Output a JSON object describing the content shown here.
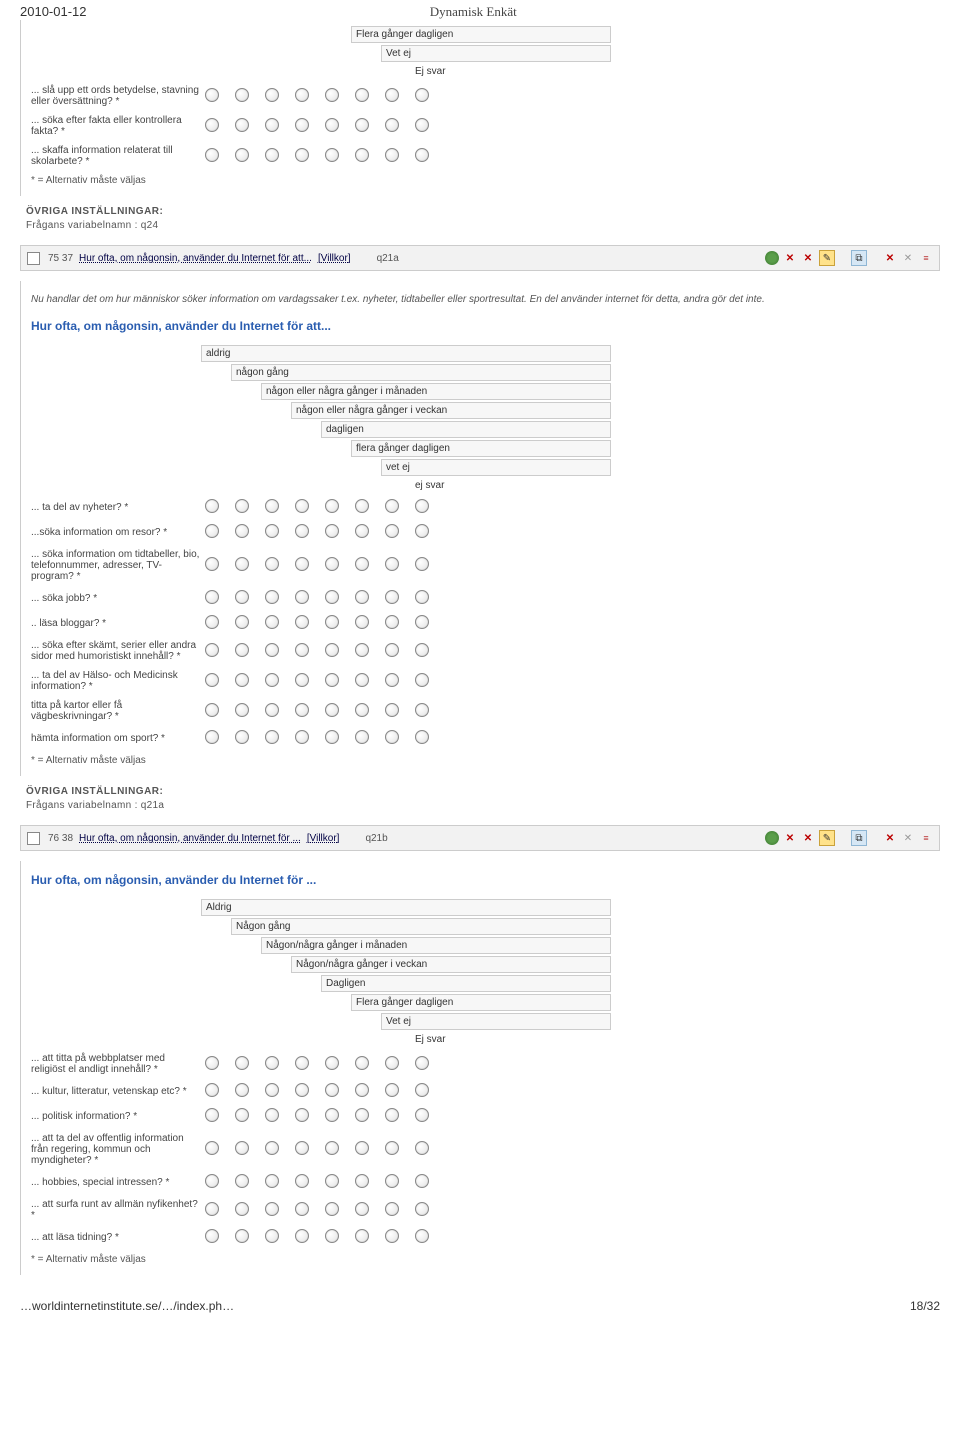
{
  "header": {
    "date": "2010-01-12",
    "title": "Dynamisk Enkät"
  },
  "footer": {
    "left": "…worldinternetinstitute.se/…/index.ph…",
    "right": "18/32"
  },
  "common": {
    "footnote": "* = Alternativ måste väljas",
    "settings_title": "ÖVRIGA INSTÄLLNINGAR:",
    "villkor": "[Villkor]"
  },
  "block_top": {
    "scale_partial": [
      "Flera gånger dagligen",
      "Vet ej",
      "Ej svar"
    ],
    "rows": [
      "... slå upp ett ords betydelse, stavning eller översättning? *",
      "... söka efter fakta eller kontrollera fakta? *",
      "... skaffa information relaterat till skolarbete? *"
    ],
    "variable": "Frågans variabelnamn : q24"
  },
  "q75": {
    "nums": "75  37",
    "link": "Hur ofta, om någonsin, använder du Internet för att...",
    "code": "q21a",
    "preamble": "Nu handlar det om hur människor söker information om vardagssaker t.ex. nyheter, tidtabeller eller sportresultat. En del använder internet för detta, andra gör det inte.",
    "heading": "Hur ofta, om någonsin, använder du Internet för att...",
    "scale": [
      "aldrig",
      "någon gång",
      "någon eller några gånger i månaden",
      "någon eller några gånger i veckan",
      "dagligen",
      "flera gånger dagligen",
      "vet ej",
      "ej svar"
    ],
    "rows": [
      "... ta del av nyheter? *",
      "...söka information om resor? *",
      "... söka information om tidtabeller, bio, telefonnummer, adresser, TV-program? *",
      "... söka jobb? *",
      ".. läsa bloggar? *",
      "... söka efter skämt, serier eller andra sidor med humoristiskt innehåll? *",
      "... ta del av Hälso- och Medicinsk information? *",
      " titta på kartor eller få vägbeskrivningar? *",
      " hämta information om sport? *"
    ],
    "variable": "Frågans variabelnamn : q21a"
  },
  "q76": {
    "nums": "76  38",
    "link": "Hur ofta, om någonsin, använder du Internet för ...",
    "code": "q21b",
    "heading": "Hur ofta, om någonsin, använder du Internet för ...",
    "scale": [
      "Aldrig",
      "Någon gång",
      "Någon/några gånger i månaden",
      "Någon/några gånger i veckan",
      "Dagligen",
      "Flera gånger dagligen",
      "Vet ej",
      "Ej svar"
    ],
    "rows": [
      "... att titta på webbplatser med religiöst el andligt innehåll? *",
      "... kultur, litteratur, vetenskap etc? *",
      "... politisk information? *",
      "... att ta del av offentlig information från regering, kommun och myndigheter? *",
      "... hobbies, special intressen? *",
      "... att surfa runt av allmän nyfikenhet? *",
      "... att läsa tidning? *"
    ]
  }
}
